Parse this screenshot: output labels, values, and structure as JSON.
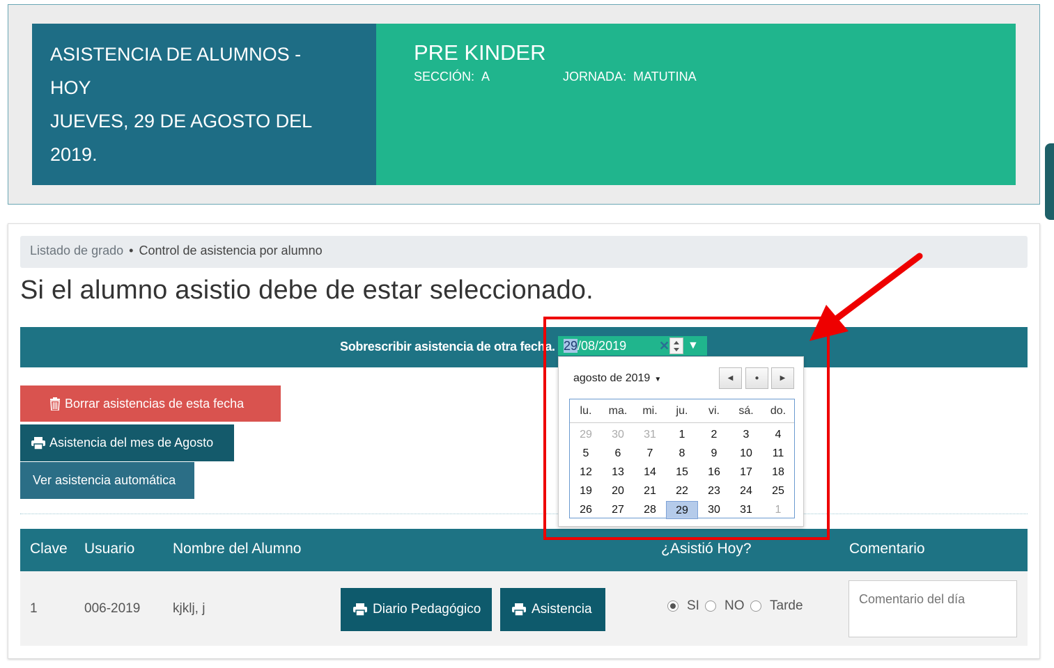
{
  "header": {
    "title_line1": "ASISTENCIA DE ALUMNOS -",
    "title_line2": "HOY",
    "date_line1": "JUEVES, 29 DE AGOSTO DEL",
    "date_line2": "2019.",
    "grade": "PRE KINDER",
    "section_label": "SECCIÓN:",
    "section_value": "A",
    "shift_label": "JORNADA:",
    "shift_value": "MATUTINA"
  },
  "breadcrumb": {
    "link": "Listado de grado",
    "separator": "•",
    "current": "Control de asistencia por alumno"
  },
  "heading": "Si el alumno asistio debe de estar seleccionado.",
  "override": {
    "label": "Sobrescribir asistencia de otra fecha.",
    "date_day_selected": "29",
    "date_rest": "/08/2019"
  },
  "actions": {
    "delete_label": "Borrar asistencias de esta fecha",
    "month_label": "Asistencia del mes de Agosto",
    "auto_label": "Ver asistencia automática"
  },
  "table": {
    "headers": [
      "Clave",
      "Usuario",
      "Nombre del Alumno",
      "¿Asistió Hoy?",
      "Comentario"
    ],
    "rows": [
      {
        "clave": "1",
        "usuario": "006-2019",
        "nombre": "kjklj, j",
        "diario_label": "Diario Pedagógico",
        "asistencia_label": "Asistencia",
        "options": [
          "SI",
          "NO",
          "Tarde"
        ],
        "selected_option": "SI",
        "comment_placeholder": "Comentario del día"
      }
    ]
  },
  "calendar": {
    "month_label": "agosto de 2019",
    "weekdays": [
      "lu.",
      "ma.",
      "mi.",
      "ju.",
      "vi.",
      "sá.",
      "do."
    ],
    "weeks": [
      [
        "29",
        "30",
        "31",
        "1",
        "2",
        "3",
        "4"
      ],
      [
        "5",
        "6",
        "7",
        "8",
        "9",
        "10",
        "11"
      ],
      [
        "12",
        "13",
        "14",
        "15",
        "16",
        "17",
        "18"
      ],
      [
        "19",
        "20",
        "21",
        "22",
        "23",
        "24",
        "25"
      ],
      [
        "26",
        "27",
        "28",
        "29",
        "30",
        "31",
        "1"
      ]
    ],
    "selected_day": "29"
  },
  "colors": {
    "header_left_bg": "#1e6d85",
    "header_right_bg": "#20b58d",
    "bar_bg": "#1e7384",
    "delete_bg": "#d9534f",
    "annotation": "#ee0000"
  }
}
